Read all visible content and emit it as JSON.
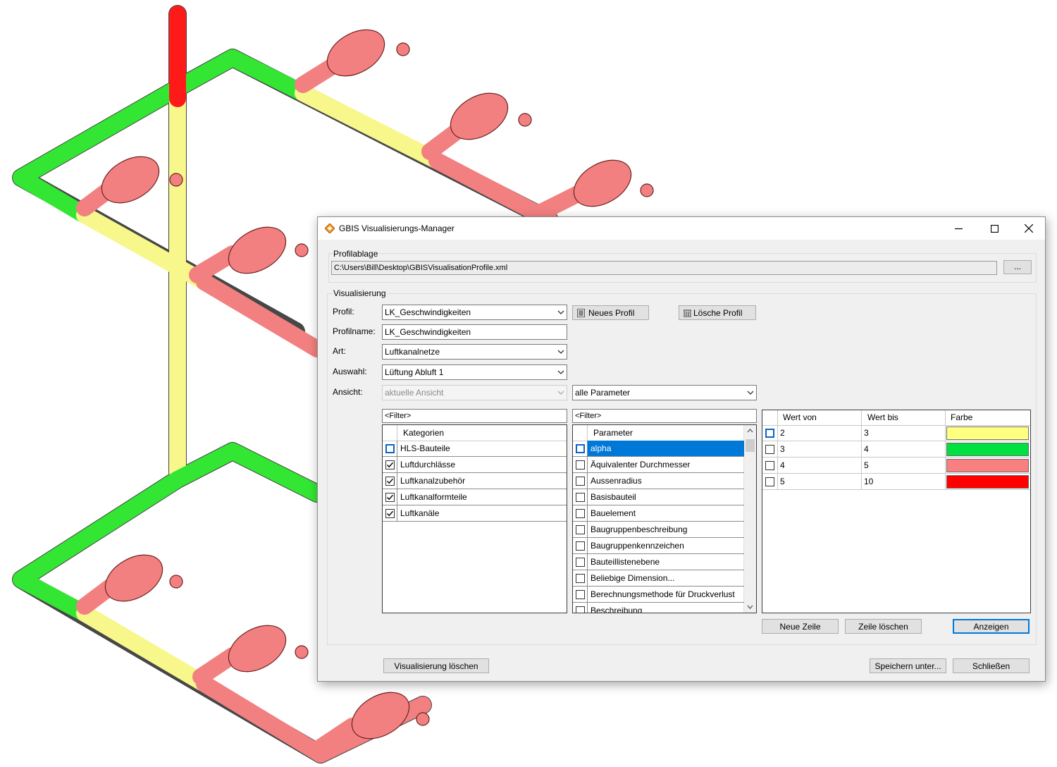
{
  "window": {
    "title": "GBIS Visualisierungs-Manager",
    "controls": [
      "minimize",
      "maximize",
      "close"
    ]
  },
  "profilablage": {
    "label": "Profilablage",
    "path": "C:\\Users\\Bill\\Desktop\\GBISVisualisationProfile.xml",
    "browse_label": "..."
  },
  "visualisierung": {
    "label": "Visualisierung",
    "profil_label": "Profil:",
    "profil_value": "LK_Geschwindigkeiten",
    "neues_profil_label": "Neues Profil",
    "loesche_profil_label": "Lösche Profil",
    "profilname_label": "Profilname:",
    "profilname_value": "LK_Geschwindigkeiten",
    "art_label": "Art:",
    "art_value": "Luftkanalnetze",
    "auswahl_label": "Auswahl:",
    "auswahl_value": "Lüftung Abluft 1",
    "ansicht_label": "Ansicht:",
    "ansicht_value": "aktuelle Ansicht",
    "parameter_filter_value": "alle Parameter"
  },
  "kategorien": {
    "filter_placeholder": "<Filter>",
    "header": "Kategorien",
    "items": [
      {
        "label": "HLS-Bauteile",
        "checked": false
      },
      {
        "label": "Luftdurchlässe",
        "checked": true
      },
      {
        "label": "Luftkanalzubehör",
        "checked": true
      },
      {
        "label": "Luftkanalformteile",
        "checked": true
      },
      {
        "label": "Luftkanäle",
        "checked": true
      }
    ]
  },
  "parameter": {
    "filter_placeholder": "<Filter>",
    "header": "Parameter",
    "items": [
      {
        "label": "alpha",
        "checked": false,
        "selected": true
      },
      {
        "label": "Äquivalenter Durchmesser",
        "checked": false
      },
      {
        "label": "Aussenradius",
        "checked": false
      },
      {
        "label": "Basisbauteil",
        "checked": false
      },
      {
        "label": "Bauelement",
        "checked": false
      },
      {
        "label": "Baugruppenbeschreibung",
        "checked": false
      },
      {
        "label": "Baugruppenkennzeichen",
        "checked": false
      },
      {
        "label": "Bauteillistenebene",
        "checked": false
      },
      {
        "label": "Beliebige Dimension...",
        "checked": false
      },
      {
        "label": "Berechnungsmethode für Druckverlust",
        "checked": false
      },
      {
        "label": "Beschreibung",
        "checked": false
      }
    ]
  },
  "farbtabelle": {
    "headers": {
      "von": "Wert von",
      "bis": "Wert bis",
      "farbe": "Farbe"
    },
    "rows": [
      {
        "von": "2",
        "bis": "3",
        "color": "#ffff80"
      },
      {
        "von": "3",
        "bis": "4",
        "color": "#00e040"
      },
      {
        "von": "4",
        "bis": "5",
        "color": "#f88080"
      },
      {
        "von": "5",
        "bis": "10",
        "color": "#ff0000"
      }
    ],
    "neue_zeile_label": "Neue Zeile",
    "zeile_loeschen_label": "Zeile löschen",
    "anzeigen_label": "Anzeigen"
  },
  "footer": {
    "visualisierung_loeschen_label": "Visualisierung löschen",
    "speichern_unter_label": "Speichern unter...",
    "schliessen_label": "Schließen"
  },
  "colors": {
    "accent": "#0078d7",
    "duct_green": "#33e633",
    "duct_yellow": "#f7f78c",
    "duct_red": "#f28080",
    "duct_strong_red": "#ff1a1a"
  }
}
